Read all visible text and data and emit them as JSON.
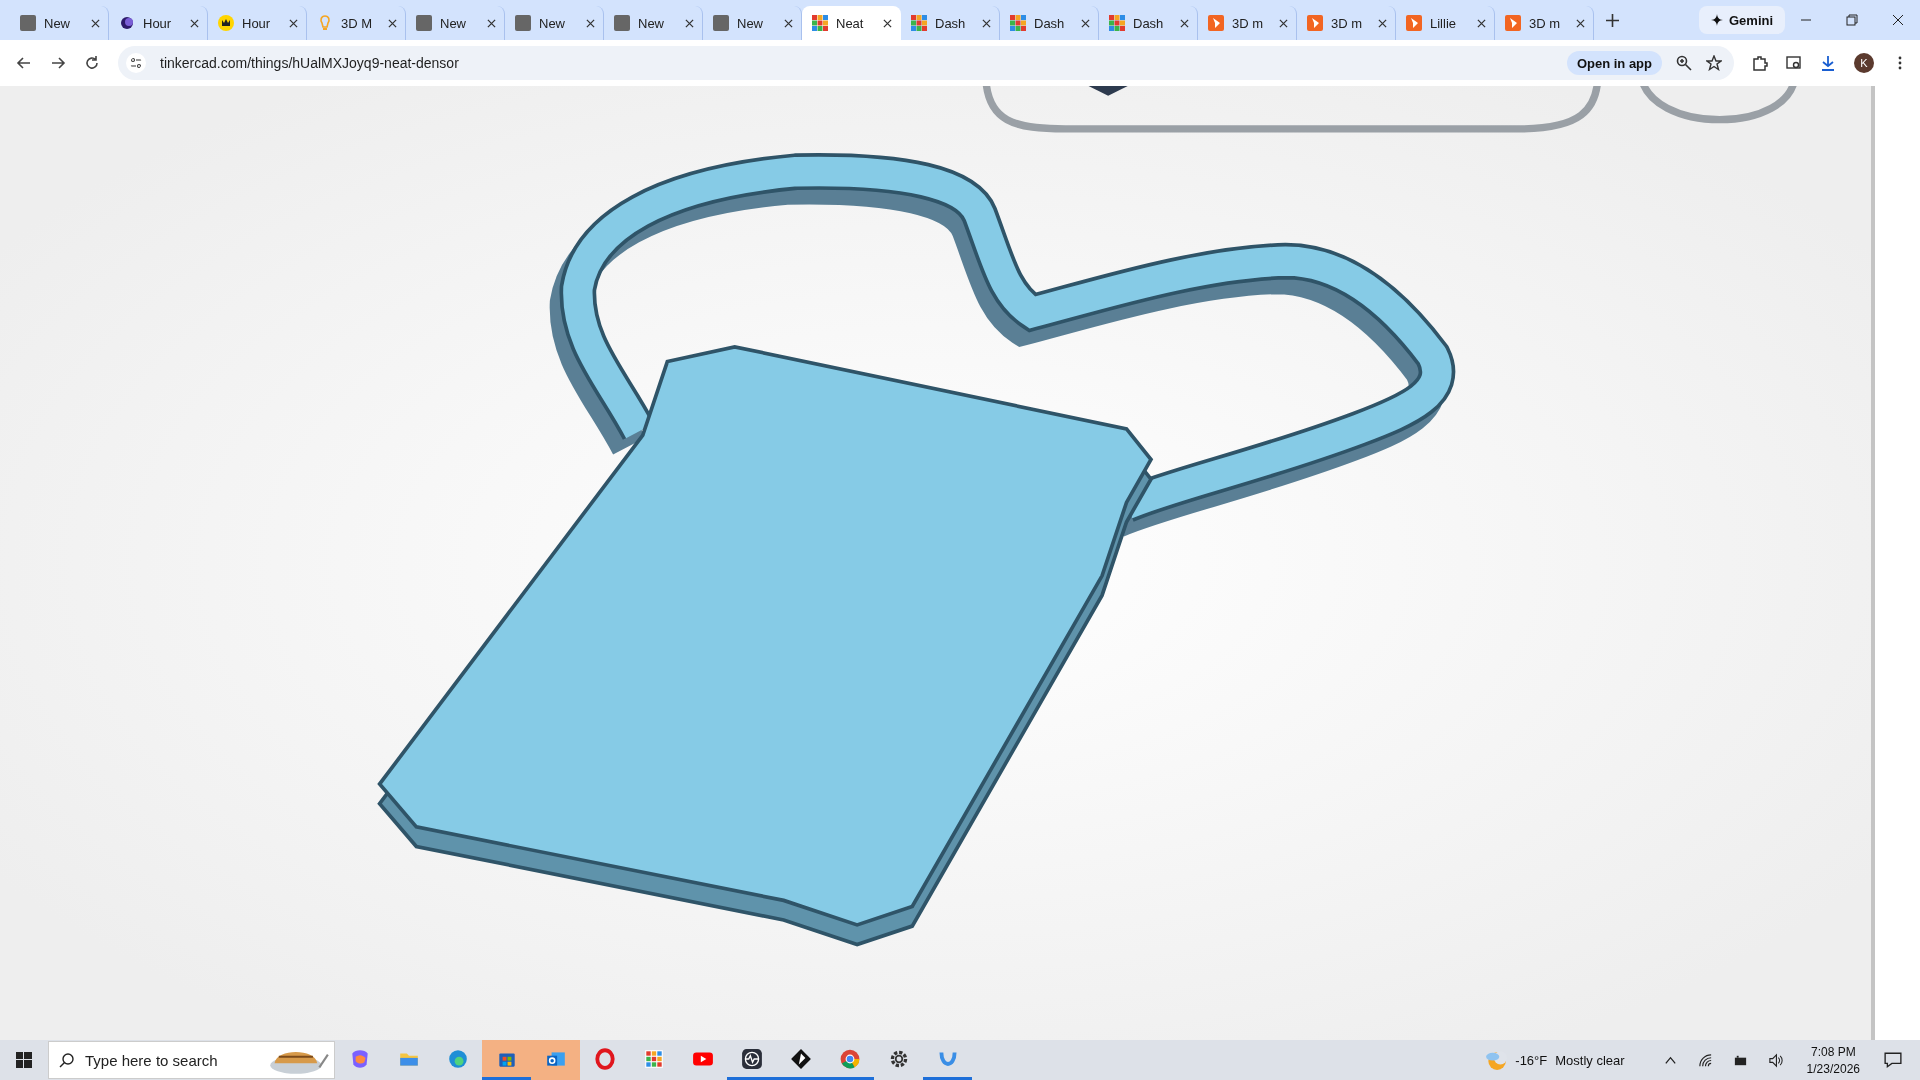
{
  "tabs": [
    {
      "label": "New",
      "kind": "s",
      "selected": false
    },
    {
      "label": "Hour",
      "kind": "moon",
      "selected": false
    },
    {
      "label": "Hour",
      "kind": "crown",
      "selected": false
    },
    {
      "label": "3D M",
      "kind": "bulb",
      "selected": false
    },
    {
      "label": "New",
      "kind": "s",
      "selected": false
    },
    {
      "label": "New",
      "kind": "s",
      "selected": false
    },
    {
      "label": "New",
      "kind": "s",
      "selected": false
    },
    {
      "label": "New",
      "kind": "s",
      "selected": false
    },
    {
      "label": "Neat",
      "kind": "grid",
      "selected": true
    },
    {
      "label": "Dash",
      "kind": "grid",
      "selected": false
    },
    {
      "label": "Dash",
      "kind": "grid",
      "selected": false
    },
    {
      "label": "Dash",
      "kind": "grid",
      "selected": false
    },
    {
      "label": "3D m",
      "kind": "play",
      "selected": false
    },
    {
      "label": "3D m",
      "kind": "play",
      "selected": false
    },
    {
      "label": "Lillie",
      "kind": "play",
      "selected": false
    },
    {
      "label": "3D m",
      "kind": "play",
      "selected": false
    }
  ],
  "gemini": {
    "label": "Gemini"
  },
  "address_bar": {
    "url": "tinkercad.com/things/hUalMXJoyq9-neat-densor",
    "open_in_app": "Open in app",
    "avatar": "K"
  },
  "taskbar": {
    "search_placeholder": "Type here to search",
    "apps": [
      {
        "kind": "copilot",
        "running": false,
        "highlighted": false
      },
      {
        "kind": "folder",
        "running": false,
        "highlighted": false
      },
      {
        "kind": "edge",
        "running": false,
        "highlighted": false
      },
      {
        "kind": "store",
        "running": true,
        "highlighted": true
      },
      {
        "kind": "mail",
        "running": false,
        "highlighted": true
      },
      {
        "kind": "opera",
        "running": false,
        "highlighted": false
      },
      {
        "kind": "grid",
        "running": false,
        "highlighted": false
      },
      {
        "kind": "video",
        "running": false,
        "highlighted": false
      },
      {
        "kind": "pulse",
        "running": true,
        "highlighted": false
      },
      {
        "kind": "diamond",
        "running": true,
        "highlighted": false
      },
      {
        "kind": "chrome",
        "running": true,
        "highlighted": false
      },
      {
        "kind": "gear",
        "running": false,
        "highlighted": false
      },
      {
        "kind": "cup",
        "running": true,
        "highlighted": false
      }
    ],
    "weather": {
      "temperature": "-16°F",
      "condition": "Mostly clear"
    },
    "time": "7:08 PM",
    "date": "1/23/2026"
  }
}
